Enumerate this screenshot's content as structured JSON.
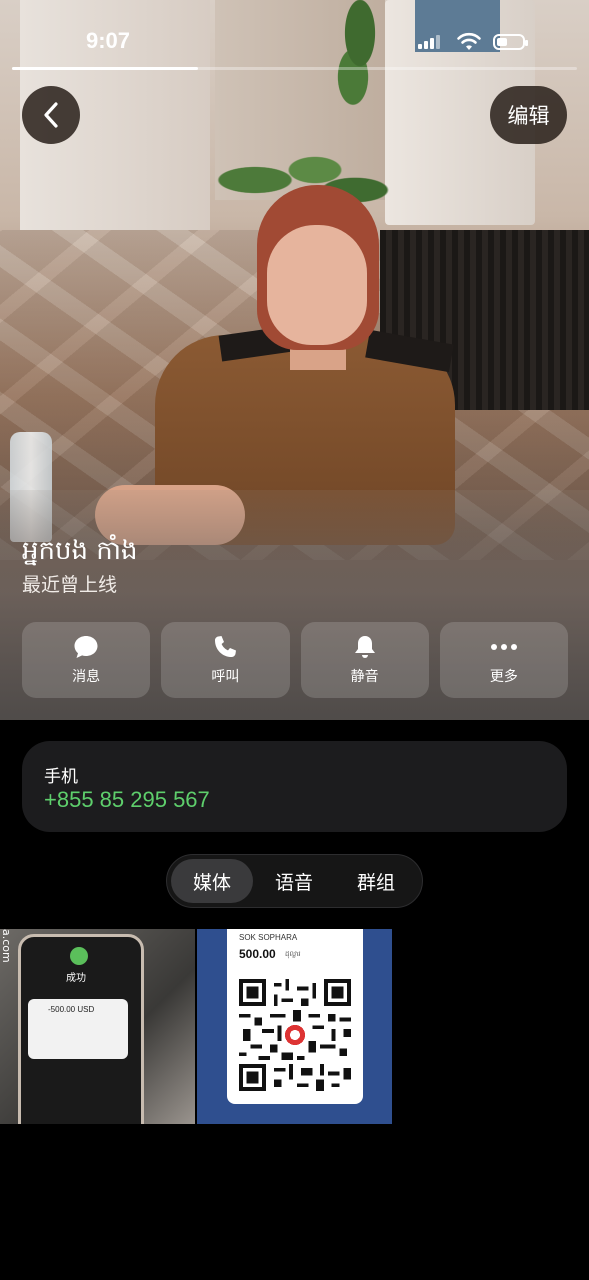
{
  "status_bar": {
    "time": "9:07",
    "story_progress": 0.33
  },
  "header": {
    "edit_label": "编辑"
  },
  "profile": {
    "name": "អ្នកបង កាំង",
    "last_seen": "最近曾上线"
  },
  "actions": [
    {
      "label": "消息",
      "icon": "message-bubble-icon"
    },
    {
      "label": "呼叫",
      "icon": "phone-icon"
    },
    {
      "label": "静音",
      "icon": "bell-icon"
    },
    {
      "label": "更多",
      "icon": "more-dots-icon"
    }
  ],
  "contact": {
    "phone_label": "手机",
    "phone_number": "+855 85 295 567"
  },
  "tabs": [
    {
      "label": "媒体",
      "active": true
    },
    {
      "label": "语音",
      "active": false
    },
    {
      "label": "群组",
      "active": false
    }
  ],
  "media": {
    "thumb1": {
      "status": "成功",
      "amount": "-500.00 USD",
      "site": "a.com"
    },
    "thumb2": {
      "name": "SOK SOPHARA",
      "amount": "500.00",
      "currency": "ដុល្លារ"
    }
  },
  "colors": {
    "accent_green": "#5ecf6c",
    "card_bg": "#1c1c1e"
  }
}
